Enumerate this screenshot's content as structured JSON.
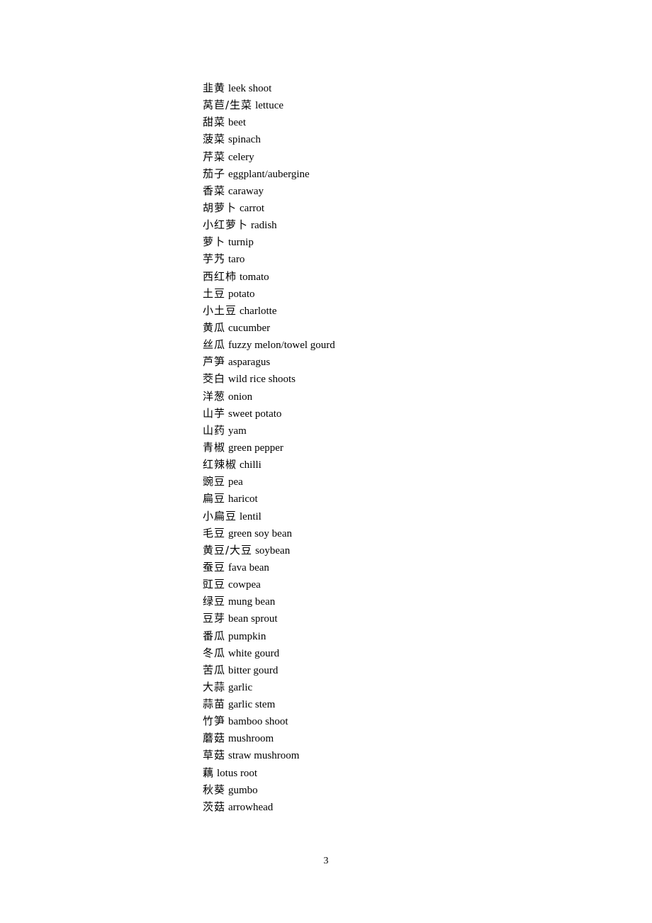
{
  "document": {
    "page_number": "3",
    "vocab": [
      {
        "zh": "韭黄",
        "en": "leek shoot"
      },
      {
        "zh": "莴苣/生菜",
        "en": "lettuce"
      },
      {
        "zh": "甜菜",
        "en": "beet"
      },
      {
        "zh": "菠菜",
        "en": "spinach"
      },
      {
        "zh": "芹菜",
        "en": "celery"
      },
      {
        "zh": "茄子",
        "en": "eggplant/aubergine"
      },
      {
        "zh": "香菜",
        "en": "caraway"
      },
      {
        "zh": "胡萝卜",
        "en": "carrot"
      },
      {
        "zh": "小红萝卜",
        "en": "radish"
      },
      {
        "zh": "萝卜",
        "en": "turnip"
      },
      {
        "zh": "芋艿",
        "en": "taro"
      },
      {
        "zh": "西红柿",
        "en": "tomato"
      },
      {
        "zh": "土豆",
        "en": "potato"
      },
      {
        "zh": "小土豆",
        "en": "charlotte"
      },
      {
        "zh": "黄瓜",
        "en": "cucumber"
      },
      {
        "zh": "丝瓜",
        "en": "fuzzy melon/towel gourd"
      },
      {
        "zh": "芦笋",
        "en": "asparagus"
      },
      {
        "zh": "茭白",
        "en": "wild rice shoots"
      },
      {
        "zh": "洋葱",
        "en": "onion"
      },
      {
        "zh": "山芋",
        "en": "sweet potato"
      },
      {
        "zh": "山药",
        "en": "yam"
      },
      {
        "zh": "青椒",
        "en": "green pepper"
      },
      {
        "zh": "红辣椒",
        "en": "chilli"
      },
      {
        "zh": "豌豆",
        "en": "pea"
      },
      {
        "zh": "扁豆",
        "en": "haricot"
      },
      {
        "zh": "小扁豆",
        "en": "lentil"
      },
      {
        "zh": "毛豆",
        "en": "green soy bean"
      },
      {
        "zh": "黄豆/大豆",
        "en": "soybean"
      },
      {
        "zh": "蚕豆",
        "en": "fava bean"
      },
      {
        "zh": "豇豆",
        "en": "cowpea"
      },
      {
        "zh": "绿豆",
        "en": "mung bean"
      },
      {
        "zh": "豆芽",
        "en": "bean sprout"
      },
      {
        "zh": "番瓜",
        "en": "pumpkin"
      },
      {
        "zh": "冬瓜",
        "en": "white gourd"
      },
      {
        "zh": "苦瓜",
        "en": "bitter gourd"
      },
      {
        "zh": "大蒜",
        "en": "garlic"
      },
      {
        "zh": "蒜苗",
        "en": "garlic stem"
      },
      {
        "zh": "竹笋",
        "en": "bamboo shoot"
      },
      {
        "zh": "蘑菇",
        "en": "mushroom"
      },
      {
        "zh": "草菇",
        "en": "straw mushroom"
      },
      {
        "zh": "藕",
        "en": "lotus root"
      },
      {
        "zh": "秋葵",
        "en": "gumbo"
      },
      {
        "zh": "茨菇",
        "en": "arrowhead"
      }
    ]
  }
}
